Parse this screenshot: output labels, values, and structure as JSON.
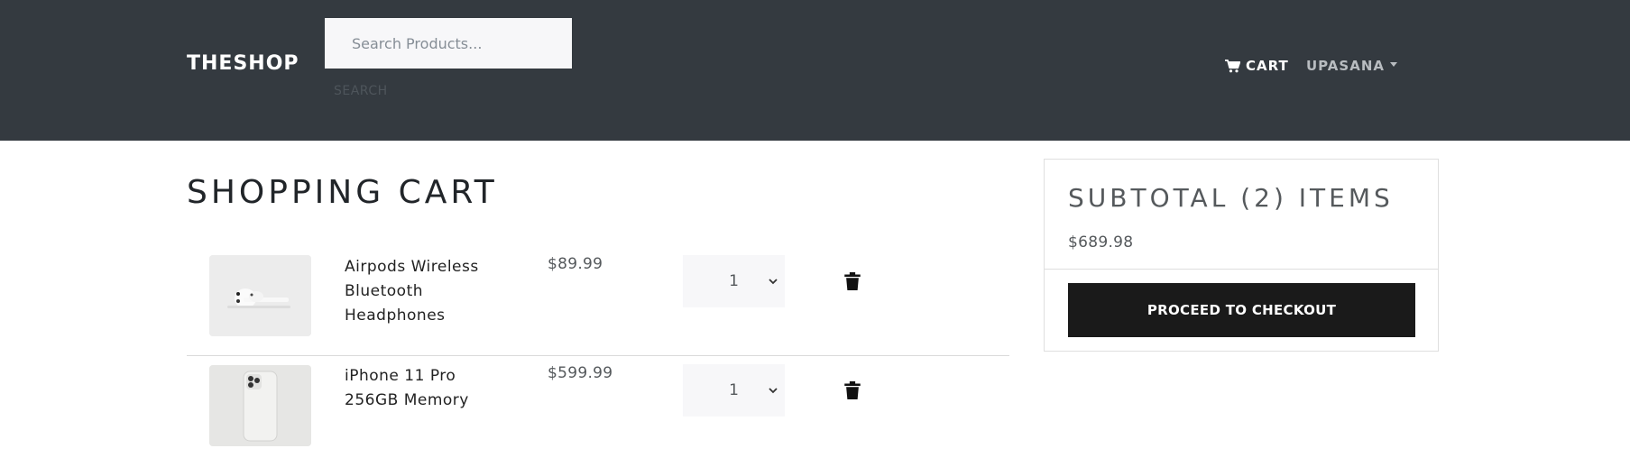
{
  "header": {
    "brand": "THESHOP",
    "search": {
      "placeholder": "Search Products...",
      "button_label": "SEARCH"
    },
    "cart_label": "CART",
    "user_label": "UPASANA"
  },
  "main": {
    "title": "SHOPPING CART",
    "items": [
      {
        "name": "Airpods Wireless Bluetooth Headphones",
        "price": "$89.99",
        "qty": "1",
        "image": "airpods-image"
      },
      {
        "name": "iPhone 11 Pro 256GB Memory",
        "price": "$599.99",
        "qty": "1",
        "image": "iphone-image"
      }
    ]
  },
  "summary": {
    "title": "SUBTOTAL (2) ITEMS",
    "total": "$689.98",
    "checkout_label": "PROCEED TO CHECKOUT"
  },
  "icons": {
    "cart": "shopping-cart-icon",
    "dropdown": "caret-down-icon",
    "delete": "trash-icon",
    "select": "chevron-down-icon"
  },
  "colors": {
    "navbar_bg": "#343a40",
    "input_bg": "#f7f7f9",
    "button_bg": "#1a1a1a"
  }
}
